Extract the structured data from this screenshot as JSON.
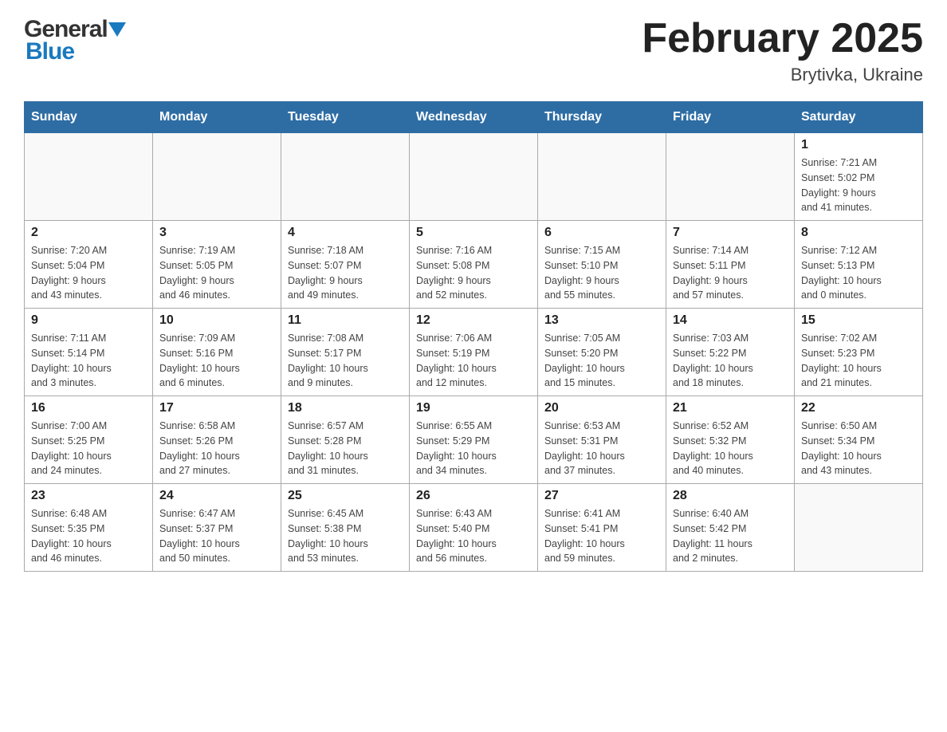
{
  "header": {
    "logo_general": "General",
    "logo_blue": "Blue",
    "title": "February 2025",
    "subtitle": "Brytivka, Ukraine"
  },
  "weekdays": [
    "Sunday",
    "Monday",
    "Tuesday",
    "Wednesday",
    "Thursday",
    "Friday",
    "Saturday"
  ],
  "weeks": [
    [
      {
        "day": "",
        "info": ""
      },
      {
        "day": "",
        "info": ""
      },
      {
        "day": "",
        "info": ""
      },
      {
        "day": "",
        "info": ""
      },
      {
        "day": "",
        "info": ""
      },
      {
        "day": "",
        "info": ""
      },
      {
        "day": "1",
        "info": "Sunrise: 7:21 AM\nSunset: 5:02 PM\nDaylight: 9 hours\nand 41 minutes."
      }
    ],
    [
      {
        "day": "2",
        "info": "Sunrise: 7:20 AM\nSunset: 5:04 PM\nDaylight: 9 hours\nand 43 minutes."
      },
      {
        "day": "3",
        "info": "Sunrise: 7:19 AM\nSunset: 5:05 PM\nDaylight: 9 hours\nand 46 minutes."
      },
      {
        "day": "4",
        "info": "Sunrise: 7:18 AM\nSunset: 5:07 PM\nDaylight: 9 hours\nand 49 minutes."
      },
      {
        "day": "5",
        "info": "Sunrise: 7:16 AM\nSunset: 5:08 PM\nDaylight: 9 hours\nand 52 minutes."
      },
      {
        "day": "6",
        "info": "Sunrise: 7:15 AM\nSunset: 5:10 PM\nDaylight: 9 hours\nand 55 minutes."
      },
      {
        "day": "7",
        "info": "Sunrise: 7:14 AM\nSunset: 5:11 PM\nDaylight: 9 hours\nand 57 minutes."
      },
      {
        "day": "8",
        "info": "Sunrise: 7:12 AM\nSunset: 5:13 PM\nDaylight: 10 hours\nand 0 minutes."
      }
    ],
    [
      {
        "day": "9",
        "info": "Sunrise: 7:11 AM\nSunset: 5:14 PM\nDaylight: 10 hours\nand 3 minutes."
      },
      {
        "day": "10",
        "info": "Sunrise: 7:09 AM\nSunset: 5:16 PM\nDaylight: 10 hours\nand 6 minutes."
      },
      {
        "day": "11",
        "info": "Sunrise: 7:08 AM\nSunset: 5:17 PM\nDaylight: 10 hours\nand 9 minutes."
      },
      {
        "day": "12",
        "info": "Sunrise: 7:06 AM\nSunset: 5:19 PM\nDaylight: 10 hours\nand 12 minutes."
      },
      {
        "day": "13",
        "info": "Sunrise: 7:05 AM\nSunset: 5:20 PM\nDaylight: 10 hours\nand 15 minutes."
      },
      {
        "day": "14",
        "info": "Sunrise: 7:03 AM\nSunset: 5:22 PM\nDaylight: 10 hours\nand 18 minutes."
      },
      {
        "day": "15",
        "info": "Sunrise: 7:02 AM\nSunset: 5:23 PM\nDaylight: 10 hours\nand 21 minutes."
      }
    ],
    [
      {
        "day": "16",
        "info": "Sunrise: 7:00 AM\nSunset: 5:25 PM\nDaylight: 10 hours\nand 24 minutes."
      },
      {
        "day": "17",
        "info": "Sunrise: 6:58 AM\nSunset: 5:26 PM\nDaylight: 10 hours\nand 27 minutes."
      },
      {
        "day": "18",
        "info": "Sunrise: 6:57 AM\nSunset: 5:28 PM\nDaylight: 10 hours\nand 31 minutes."
      },
      {
        "day": "19",
        "info": "Sunrise: 6:55 AM\nSunset: 5:29 PM\nDaylight: 10 hours\nand 34 minutes."
      },
      {
        "day": "20",
        "info": "Sunrise: 6:53 AM\nSunset: 5:31 PM\nDaylight: 10 hours\nand 37 minutes."
      },
      {
        "day": "21",
        "info": "Sunrise: 6:52 AM\nSunset: 5:32 PM\nDaylight: 10 hours\nand 40 minutes."
      },
      {
        "day": "22",
        "info": "Sunrise: 6:50 AM\nSunset: 5:34 PM\nDaylight: 10 hours\nand 43 minutes."
      }
    ],
    [
      {
        "day": "23",
        "info": "Sunrise: 6:48 AM\nSunset: 5:35 PM\nDaylight: 10 hours\nand 46 minutes."
      },
      {
        "day": "24",
        "info": "Sunrise: 6:47 AM\nSunset: 5:37 PM\nDaylight: 10 hours\nand 50 minutes."
      },
      {
        "day": "25",
        "info": "Sunrise: 6:45 AM\nSunset: 5:38 PM\nDaylight: 10 hours\nand 53 minutes."
      },
      {
        "day": "26",
        "info": "Sunrise: 6:43 AM\nSunset: 5:40 PM\nDaylight: 10 hours\nand 56 minutes."
      },
      {
        "day": "27",
        "info": "Sunrise: 6:41 AM\nSunset: 5:41 PM\nDaylight: 10 hours\nand 59 minutes."
      },
      {
        "day": "28",
        "info": "Sunrise: 6:40 AM\nSunset: 5:42 PM\nDaylight: 11 hours\nand 2 minutes."
      },
      {
        "day": "",
        "info": ""
      }
    ]
  ]
}
